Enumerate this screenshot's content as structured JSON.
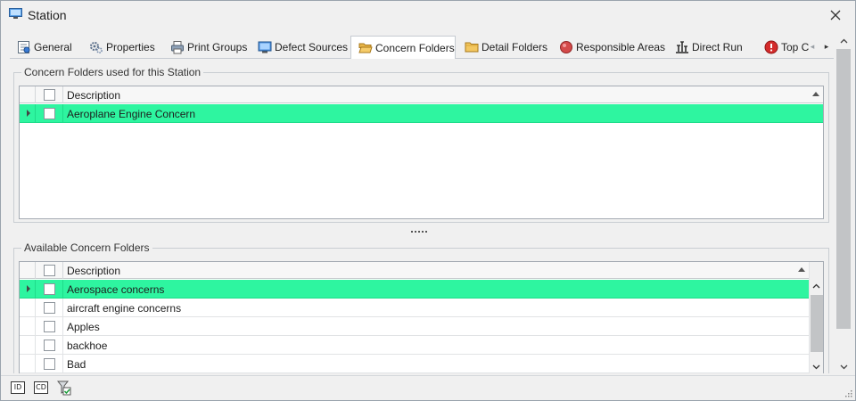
{
  "window": {
    "title": "Station"
  },
  "tabs": [
    {
      "label": "General",
      "icon": "general-icon",
      "active": false
    },
    {
      "label": "Properties",
      "icon": "gears-icon",
      "active": false
    },
    {
      "label": "Print Groups",
      "icon": "printer-icon",
      "active": false
    },
    {
      "label": "Defect Sources",
      "icon": "monitor-icon",
      "active": false
    },
    {
      "label": "Concern Folders",
      "icon": "open-folder-icon",
      "active": true
    },
    {
      "label": "Detail Folders",
      "icon": "folder-icon",
      "active": false
    },
    {
      "label": "Responsible Areas",
      "icon": "red-circle-icon",
      "active": false
    },
    {
      "label": "Direct Run",
      "icon": "direct-run-icon",
      "active": false
    },
    {
      "label": "Top Cc",
      "icon": "error-icon",
      "active": false
    }
  ],
  "used_section": {
    "legend": "Concern Folders used for this Station",
    "column_header": "Description",
    "rows": [
      {
        "description": "Aeroplane Engine Concern",
        "selected": true
      }
    ]
  },
  "available_section": {
    "legend": "Available Concern Folders",
    "column_header": "Description",
    "rows": [
      {
        "description": "Aerospace concerns",
        "selected": true
      },
      {
        "description": "aircraft engine concerns",
        "selected": false
      },
      {
        "description": "Apples",
        "selected": false
      },
      {
        "description": "backhoe",
        "selected": false
      },
      {
        "description": "Bad",
        "selected": false
      }
    ]
  },
  "statusbar": {
    "buttons": [
      "ID",
      "CD"
    ]
  },
  "colors": {
    "selection": "#2ef5a0",
    "accent": "#1f74c4"
  }
}
